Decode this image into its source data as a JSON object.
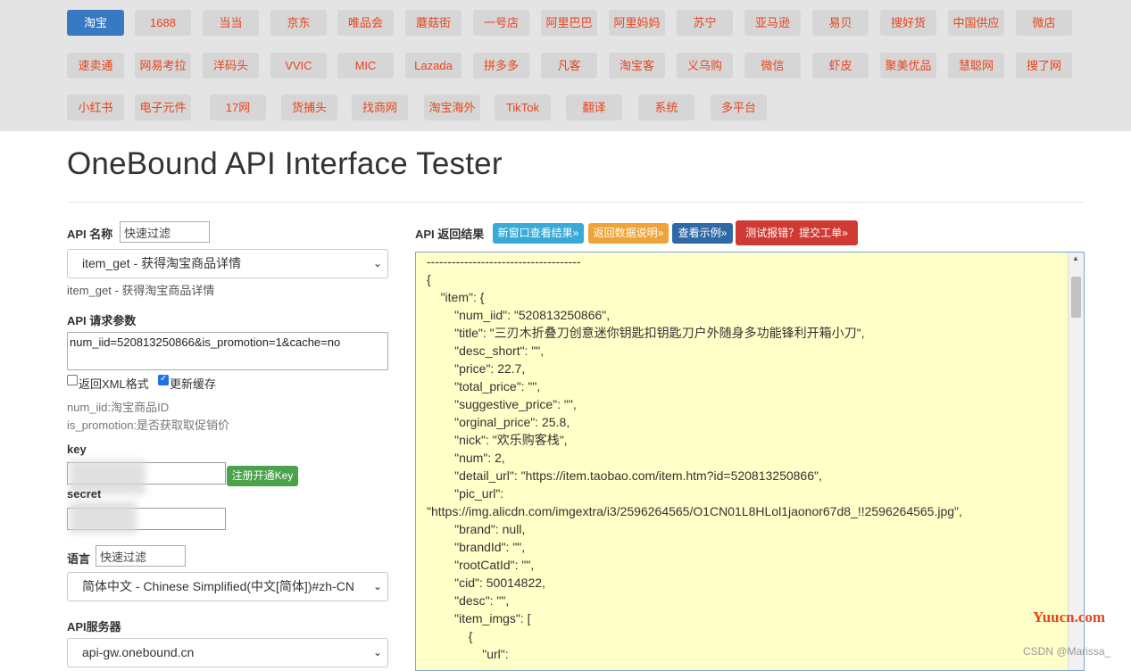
{
  "nav": {
    "row1": [
      "淘宝",
      "1688",
      "当当",
      "京东",
      "唯品会",
      "蘑菇街",
      "一号店",
      "阿里巴巴",
      "阿里妈妈",
      "苏宁",
      "亚马逊",
      "易贝",
      "搜好货",
      "中国供应",
      "微店"
    ],
    "row2": [
      "速卖通",
      "网易考拉",
      "洋码头",
      "VVIC",
      "MIC",
      "Lazada",
      "拼多多",
      "凡客",
      "淘宝客",
      "义乌购",
      "微信",
      "虾皮",
      "聚美优品",
      "慧聪网",
      "搜了网"
    ],
    "row3": [
      "小红书",
      "电子元件",
      "17网",
      "货捕头",
      "找商网",
      "淘宝海外",
      "TikTok",
      "翻译",
      "系统",
      "多平台"
    ],
    "active": "淘宝"
  },
  "page": {
    "title": "OneBound API Interface Tester"
  },
  "form": {
    "api_name_label": "API 名称",
    "filter_placeholder": "快速过滤",
    "api_select_value": "item_get - 获得淘宝商品详情",
    "api_desc": "item_get - 获得淘宝商品详情",
    "params_label": "API 请求参数",
    "params_value": "num_iid=520813250866&is_promotion=1&cache=no",
    "xml_label": "返回XML格式",
    "xml_checked": false,
    "cache_label": "更新缓存",
    "cache_checked": true,
    "param_help": [
      "num_iid:淘宝商品ID",
      "is_promotion:是否获取取促销价"
    ],
    "key_label": "key",
    "register_btn": "注册开通Key",
    "secret_label": "secret",
    "lang_label": "语言",
    "lang_select_value": "简体中文 - Chinese Simplified(中文[简体])#zh-CN",
    "server_label": "API服务器",
    "server_select_value": "api-gw.onebound.cn"
  },
  "result": {
    "label": "API 返回结果",
    "btn_new_window": "新窗口查看结果»",
    "btn_doc": "返回数据说明»",
    "btn_example": "查看示例»",
    "btn_report": "测试报错？提交工单»",
    "lines": [
      "-------------------------------------",
      "{",
      "\t\"item\": {",
      "\t\t\"num_iid\": \"520813250866\",",
      "\t\t\"title\": \"三刃木折叠刀创意迷你钥匙扣钥匙刀户外随身多功能锋利开箱小刀\",",
      "\t\t\"desc_short\": \"\",",
      "\t\t\"price\": 22.7,",
      "\t\t\"total_price\": \"\",",
      "\t\t\"suggestive_price\": \"\",",
      "\t\t\"orginal_price\": 25.8,",
      "\t\t\"nick\": \"欢乐购客栈\",",
      "\t\t\"num\": 2,",
      "\t\t\"detail_url\": \"https://item.taobao.com/item.htm?id=520813250866\",",
      "\t\t\"pic_url\":",
      "\"https://img.alicdn.com/imgextra/i3/2596264565/O1CN01L8HLol1jaonor67d8_!!2596264565.jpg\",",
      "\t\t\"brand\": null,",
      "\t\t\"brandId\": \"\",",
      "\t\t\"rootCatId\": \"\",",
      "\t\t\"cid\": 50014822,",
      "\t\t\"desc\": \"\",",
      "\t\t\"item_imgs\": [",
      "\t\t\t{",
      "\t\t\t\t\"url\":"
    ]
  },
  "watermark": {
    "site": "Yuucn.com",
    "credit": "CSDN @Marissa_"
  }
}
